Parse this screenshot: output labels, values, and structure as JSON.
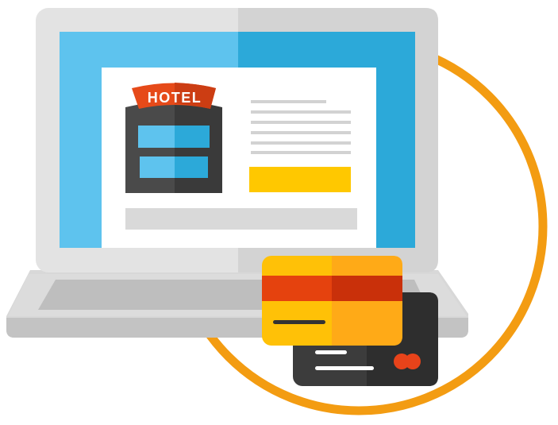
{
  "scene": {
    "hotel_sign_text": "HOTEL",
    "icons": [
      "laptop-icon",
      "hotel-building-icon",
      "credit-card-icon",
      "booking-circle"
    ],
    "colors": {
      "circle": "#F39C12",
      "screen_left": "#5EC3EE",
      "screen_right": "#2CA9D9",
      "laptop_body": "#E3E3E3",
      "hotel_sign": "#E64A19",
      "button_yellow": "#FFC800",
      "card_front_yellow": "#FFC107",
      "card_stripe": "#E5420E",
      "card_back": "#3C3C3C",
      "card_logo": "#E8431A"
    }
  }
}
